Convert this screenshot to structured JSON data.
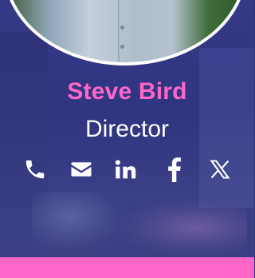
{
  "profile": {
    "name": "Steve Bird",
    "role": "Director"
  },
  "social": [
    {
      "icon": "phone-icon"
    },
    {
      "icon": "email-icon"
    },
    {
      "icon": "linkedin-icon"
    },
    {
      "icon": "facebook-icon"
    },
    {
      "icon": "x-twitter-icon"
    }
  ],
  "colors": {
    "accent": "#ff66c9",
    "background": "#2f3580",
    "text": "#ffffff"
  }
}
